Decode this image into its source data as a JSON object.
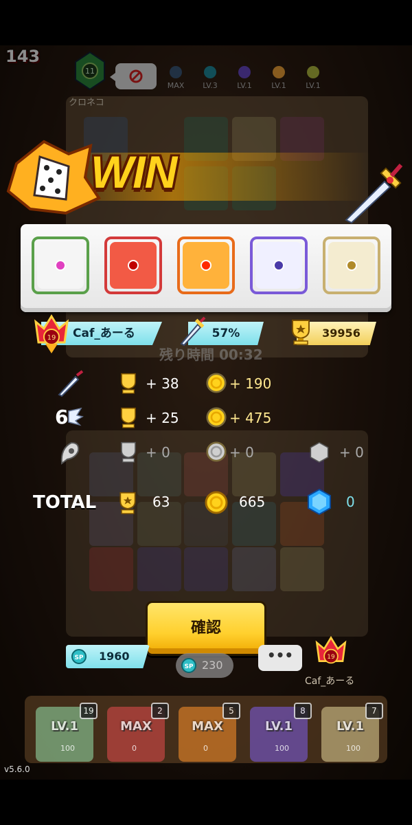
{
  "opponent": {
    "wave": "143",
    "name": "クロネコ",
    "level_labels": [
      "MAX",
      "LV.3",
      "LV.1",
      "LV.1",
      "LV.1"
    ],
    "level_colors": [
      "#3c5a7a",
      "#1f8fa0",
      "#6a4ac8",
      "#f6a63a",
      "#b7c040"
    ]
  },
  "timer": {
    "label": "残り時間 00:32"
  },
  "result": {
    "title": "WIN"
  },
  "result_dice": [
    {
      "name": "Rainbow",
      "frame": "#5aa04a",
      "bg": "#f5f5f5",
      "mark": "#e040c0"
    },
    {
      "name": "Fire",
      "frame": "#d33a3a",
      "bg": "#f25a45",
      "mark": "#c00000"
    },
    {
      "name": "Sun",
      "frame": "#e86b1a",
      "bg": "#ffb23b",
      "mark": "#ff2a00"
    },
    {
      "name": "Moon",
      "frame": "#7a5ad8",
      "bg": "#f0f0ff",
      "mark": "#4a3aa8"
    },
    {
      "name": "Holy",
      "frame": "#c8b070",
      "bg": "#f4ecd0",
      "mark": "#b08a2a"
    }
  ],
  "player": {
    "level": "19",
    "name": "Caf_あーる",
    "win_rate": "57%",
    "trophies": "39956"
  },
  "rewards": {
    "rows": [
      {
        "multiplier": "",
        "trophy": "+ 38",
        "gold": "+ 190",
        "gem": ""
      },
      {
        "multiplier": "6",
        "trophy": "+ 25",
        "gold": "+ 475",
        "gem": ""
      },
      {
        "multiplier": "",
        "trophy": "+ 0",
        "gold": "+ 0",
        "gem": "+ 0"
      }
    ],
    "total_label": "TOTAL",
    "total_trophy": "63",
    "total_gold": "665",
    "total_gem": "0"
  },
  "confirm_label": "確認",
  "bottom": {
    "sp_label": "SP",
    "sp_value": "1960",
    "summon_cost": "230",
    "bubble": "•••",
    "opponent_level": "19",
    "opponent_name": "Caf_あーる"
  },
  "deck": [
    {
      "level": "LV.1",
      "count": "19",
      "cost": "100",
      "color": "#8fd4a0"
    },
    {
      "level": "MAX",
      "count": "2",
      "cost": "0",
      "color": "#d84a4a"
    },
    {
      "level": "MAX",
      "count": "5",
      "cost": "0",
      "color": "#f08a2a"
    },
    {
      "level": "LV.1",
      "count": "8",
      "cost": "100",
      "color": "#7a5ad8"
    },
    {
      "level": "LV.1",
      "count": "7",
      "cost": "100",
      "color": "#d8c890"
    }
  ],
  "version": "v5.6.0"
}
